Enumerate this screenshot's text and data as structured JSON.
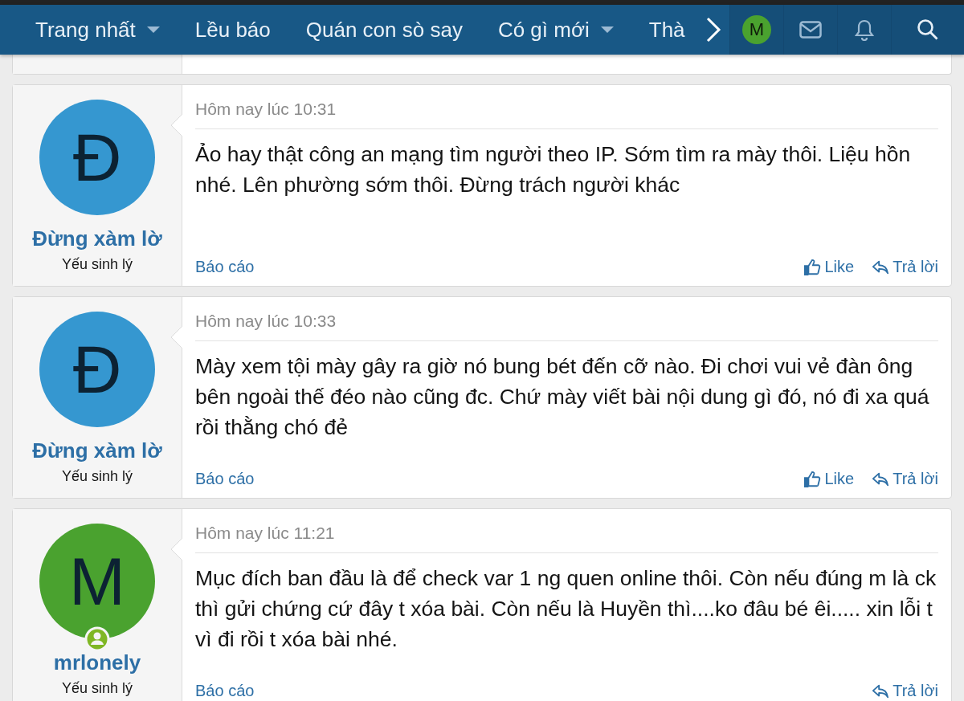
{
  "nav": {
    "items": [
      {
        "label": "Trang nhất",
        "has_menu": true
      },
      {
        "label": "Lều báo",
        "has_menu": false
      },
      {
        "label": "Quán con sò say",
        "has_menu": false
      },
      {
        "label": "Có gì mới",
        "has_menu": true
      },
      {
        "label": "Thà",
        "has_menu": false
      }
    ],
    "user_initial": "M"
  },
  "posts": [
    {
      "avatar_letter": "Đ",
      "color": "#3597d0",
      "online": false,
      "username": "Đừng xàm lờ",
      "user_title": "Yếu sinh lý",
      "date": "Hôm nay lúc 10:31",
      "message": "Ảo hay thật công an mạng tìm người theo IP. Sớm tìm ra mày thôi. Liệu hồn nhé. Lên phường sớm thôi. Đừng trách người khác",
      "report": "Báo cáo",
      "actions": [
        {
          "kind": "like",
          "label": "Like"
        },
        {
          "kind": "reply",
          "label": "Trả lời"
        }
      ]
    },
    {
      "avatar_letter": "Đ",
      "color": "#3597d0",
      "online": false,
      "username": "Đừng xàm lờ",
      "user_title": "Yếu sinh lý",
      "date": "Hôm nay lúc 10:33",
      "message": "Mày xem tội mày gây ra giờ nó bung bét đến cỡ nào. Đi chơi vui vẻ đàn ông bên ngoài thế đéo nào cũng đc. Chứ mày viết bài nội dung gì đó, nó đi xa quá rồi thằng chó đẻ",
      "report": "Báo cáo",
      "actions": [
        {
          "kind": "like",
          "label": "Like"
        },
        {
          "kind": "reply",
          "label": "Trả lời"
        }
      ]
    },
    {
      "avatar_letter": "M",
      "color": "#4aa22f",
      "online": true,
      "username": "mrlonely",
      "user_title": "Yếu sinh lý",
      "date": "Hôm nay lúc 11:21",
      "message": "Mục đích ban đầu là để check var 1 ng quen online thôi. Còn nếu đúng m là ck thì gửi chứng cứ đây t xóa bài. Còn nếu là Huyền thì....ko đâu bé êi..... xin lỗi t vì đi rồi t xóa bài nhé.",
      "report": "Báo cáo",
      "actions": [
        {
          "kind": "reply",
          "label": "Trả lời"
        }
      ]
    }
  ]
}
